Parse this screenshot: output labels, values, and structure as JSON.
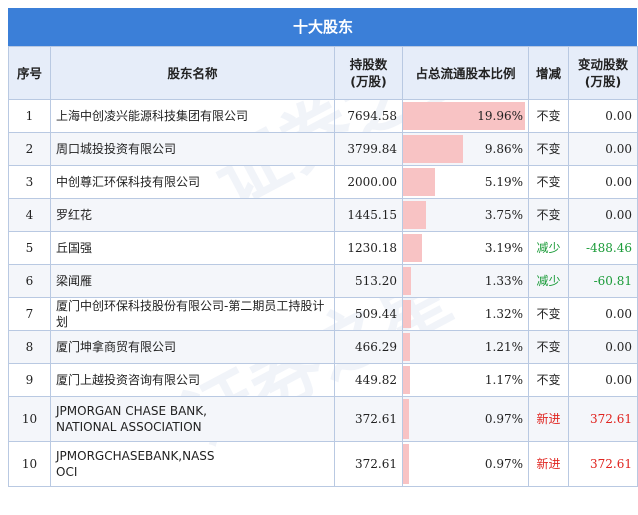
{
  "title": "十大股东",
  "headers": {
    "idx": "序号",
    "name": "股东名称",
    "shares": "持股数\n(万股)",
    "ratio": "占总流通股本比例",
    "change_type": "增减",
    "change_amount": "变动股数\n(万股)"
  },
  "rows": [
    {
      "idx": "1",
      "name": "上海中创凌兴能源科技集团有限公司",
      "shares": "7694.58",
      "ratio": "19.96%",
      "ratio_value": 19.96,
      "change_type": "不变",
      "change_amount": "0.00",
      "kind": "none"
    },
    {
      "idx": "2",
      "name": "周口城投投资有限公司",
      "shares": "3799.84",
      "ratio": "9.86%",
      "ratio_value": 9.86,
      "change_type": "不变",
      "change_amount": "0.00",
      "kind": "none"
    },
    {
      "idx": "3",
      "name": "中创尊汇环保科技有限公司",
      "shares": "2000.00",
      "ratio": "5.19%",
      "ratio_value": 5.19,
      "change_type": "不变",
      "change_amount": "0.00",
      "kind": "none"
    },
    {
      "idx": "4",
      "name": "罗红花",
      "shares": "1445.15",
      "ratio": "3.75%",
      "ratio_value": 3.75,
      "change_type": "不变",
      "change_amount": "0.00",
      "kind": "none"
    },
    {
      "idx": "5",
      "name": "丘国强",
      "shares": "1230.18",
      "ratio": "3.19%",
      "ratio_value": 3.19,
      "change_type": "减少",
      "change_amount": "-488.46",
      "kind": "down"
    },
    {
      "idx": "6",
      "name": "梁闻雁",
      "shares": "513.20",
      "ratio": "1.33%",
      "ratio_value": 1.33,
      "change_type": "减少",
      "change_amount": "-60.81",
      "kind": "down"
    },
    {
      "idx": "7",
      "name": "厦门中创环保科技股份有限公司-第二期员工持股计划",
      "shares": "509.44",
      "ratio": "1.32%",
      "ratio_value": 1.32,
      "change_type": "不变",
      "change_amount": "0.00",
      "kind": "none"
    },
    {
      "idx": "8",
      "name": "厦门坤拿商贸有限公司",
      "shares": "466.29",
      "ratio": "1.21%",
      "ratio_value": 1.21,
      "change_type": "不变",
      "change_amount": "0.00",
      "kind": "none"
    },
    {
      "idx": "9",
      "name": "厦门上越投资咨询有限公司",
      "shares": "449.82",
      "ratio": "1.17%",
      "ratio_value": 1.17,
      "change_type": "不变",
      "change_amount": "0.00",
      "kind": "none"
    },
    {
      "idx": "10",
      "name": "JPMORGAN CHASE BANK,\nNATIONAL ASSOCIATION",
      "shares": "372.61",
      "ratio": "0.97%",
      "ratio_value": 0.97,
      "change_type": "新进",
      "change_amount": "372.61",
      "kind": "up"
    },
    {
      "idx": "10",
      "name": "JPMORGCHASEBANK,NASS\nOCI",
      "shares": "372.61",
      "ratio": "0.97%",
      "ratio_value": 0.97,
      "change_type": "新进",
      "change_amount": "372.61",
      "kind": "up"
    }
  ],
  "colors": {
    "header_bg": "#3b7fd8",
    "bar": "#f8c3c4",
    "increase": "#e0241f",
    "decrease": "#1a9b38"
  }
}
